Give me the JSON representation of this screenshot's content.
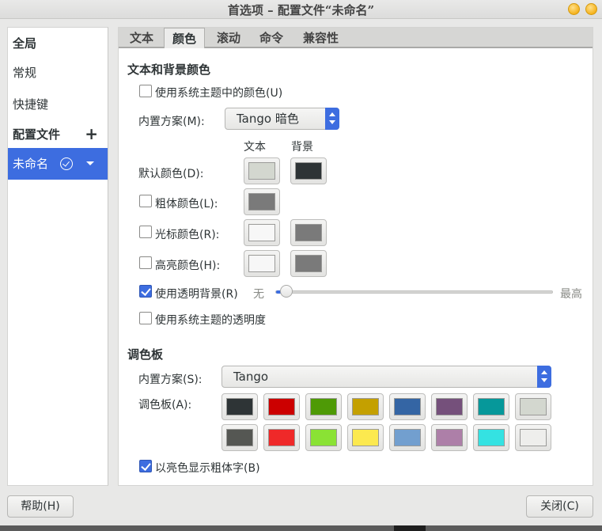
{
  "window": {
    "title": "首选项 – 配置文件“未命名”"
  },
  "sidebar": {
    "section_global": "全局",
    "item_general": "常规",
    "item_shortcuts": "快捷键",
    "section_profiles": "配置文件",
    "add_symbol": "+",
    "selected_profile": "未命名"
  },
  "tabs": [
    "文本",
    "颜色",
    "滚动",
    "命令",
    "兼容性"
  ],
  "active_tab": "颜色",
  "colors": {
    "section_title": "文本和背景颜色",
    "use_system_theme_label": "使用系统主题中的颜色(U)",
    "use_system_theme_checked": false,
    "builtin_scheme_label": "内置方案(M):",
    "builtin_scheme_value": "Tango 暗色",
    "col_text": "文本",
    "col_background": "背景",
    "default_color_label": "默认颜色(D):",
    "default_text_color": "#d3d7cf",
    "default_bg_color": "#2e3436",
    "bold_color_label": "粗体颜色(L):",
    "bold_color_checked": false,
    "bold_color": "#7a7a7a",
    "cursor_color_label": "光标颜色(R):",
    "cursor_color_checked": false,
    "cursor_text_color": "#f7f7f7",
    "cursor_bg_color": "#7a7a7a",
    "highlight_color_label": "高亮颜色(H):",
    "highlight_color_checked": false,
    "highlight_text_color": "#f7f7f7",
    "highlight_bg_color": "#7a7a7a",
    "transparent_bg_label": "使用透明背景(R)",
    "transparent_bg_checked": true,
    "slider_min_label": "无",
    "slider_max_label": "最高",
    "transparency_level": 0.02,
    "system_transparency_label": "使用系统主题的透明度",
    "system_transparency_checked": false
  },
  "palette": {
    "section_title": "调色板",
    "builtin_scheme_label": "内置方案(S):",
    "builtin_scheme_value": "Tango",
    "palette_label": "调色板(A):",
    "row1": [
      "#2e3436",
      "#cc0000",
      "#4e9a06",
      "#c4a000",
      "#3465a4",
      "#75507b",
      "#06989a",
      "#d3d7cf"
    ],
    "row2": [
      "#555753",
      "#ef2929",
      "#8ae234",
      "#fce94f",
      "#729fcf",
      "#ad7fa8",
      "#34e2e2",
      "#eeeeec"
    ],
    "bright_bold_label": "以亮色显示粗体字(B)",
    "bright_bold_checked": true
  },
  "footer": {
    "help_label": "帮助(H)",
    "close_label": "关闭(C)"
  },
  "accent_color": "#3d6de0"
}
